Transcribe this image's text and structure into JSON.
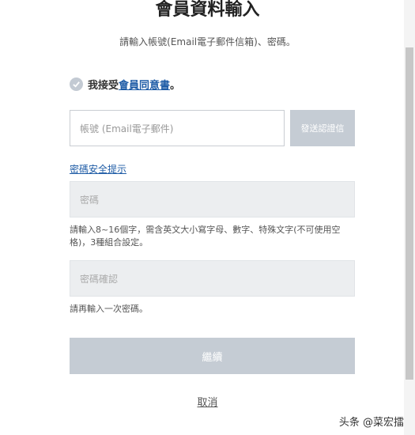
{
  "header": {
    "title": "會員資料輸入",
    "subtitle": "請輸入帳號(Email電子郵件信箱)、密碼。"
  },
  "agreement": {
    "prefix": "我接受",
    "link_label": "會員同意書",
    "suffix": "。"
  },
  "account": {
    "placeholder": "帳號 (Email電子郵件)",
    "send_code_label": "發送認證信"
  },
  "password": {
    "hint_link": "密碼安全提示",
    "placeholder": "密碼",
    "rule_text": "請輸入8~16個字，需含英文大小寫字母、數字、特殊文字(不可使用空格)，3種組合設定。"
  },
  "password_confirm": {
    "placeholder": "密碼確認",
    "helper_text": "請再輸入一次密碼。"
  },
  "actions": {
    "continue_label": "繼續",
    "cancel_label": "取消"
  },
  "watermark": "头条 @菜宏擂",
  "colors": {
    "link": "#1f5ca6",
    "disabled_button": "#c5ccd4",
    "input_disabled_bg": "#eceef0"
  }
}
